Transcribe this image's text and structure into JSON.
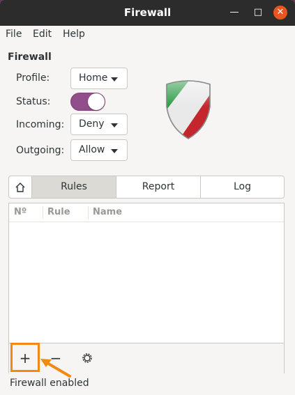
{
  "window": {
    "title": "Firewall",
    "minimize_glyph": "—",
    "maximize_glyph": "□",
    "close_glyph": "✕"
  },
  "menubar": {
    "file": "File",
    "edit": "Edit",
    "help": "Help"
  },
  "section": {
    "title": "Firewall"
  },
  "profile": {
    "label": "Profile:",
    "value": "Home"
  },
  "status": {
    "label": "Status:",
    "enabled": true
  },
  "incoming": {
    "label": "Incoming:",
    "value": "Deny"
  },
  "outgoing": {
    "label": "Outgoing:",
    "value": "Allow"
  },
  "tabs": {
    "home_icon": "home-icon",
    "rules": "Rules",
    "report": "Report",
    "log": "Log",
    "selected": "Rules"
  },
  "rules_table": {
    "columns": [
      "Nº",
      "Rule",
      "Name"
    ],
    "rows": []
  },
  "toolbar": {
    "add_glyph": "+",
    "remove_glyph": "−",
    "settings_icon": "gear-icon"
  },
  "statusbar": {
    "text": "Firewall enabled"
  },
  "colors": {
    "titlebar": "#2c2c2c",
    "close_button": "#e95420",
    "toggle_on": "#924d8b",
    "highlight": "#f28a12",
    "shield_green": "#2d9b47",
    "shield_red": "#c4262e"
  }
}
